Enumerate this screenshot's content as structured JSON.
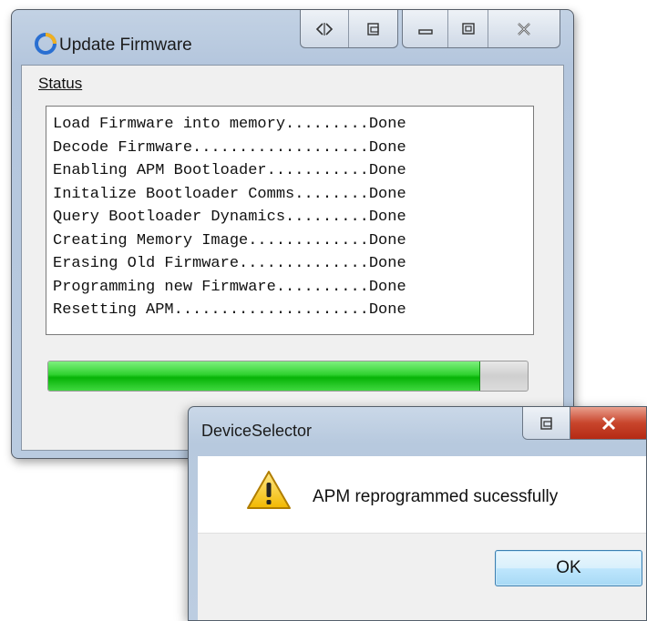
{
  "main_window": {
    "title": "Update Firmware",
    "status_label": "Status",
    "status_lines": [
      "Load Firmware into memory.........Done",
      "Decode Firmware...................Done",
      "Enabling APM Bootloader...........Done",
      "Initalize Bootloader Comms........Done",
      "Query Bootloader Dynamics.........Done",
      "Creating Memory Image.............Done",
      "Erasing Old Firmware..............Done",
      "Programming new Firmware..........Done",
      "Resetting APM.....................Done"
    ],
    "progress_fraction": 0.9,
    "titlebar_icons": [
      "split-icon",
      "restore-icon",
      "minimize-icon",
      "maximize-icon",
      "close-icon"
    ]
  },
  "dialog": {
    "title": "DeviceSelector",
    "message": "APM reprogrammed sucessfully",
    "ok_label": "OK",
    "icon": "warning-icon"
  },
  "colors": {
    "progress_green": "#07b307",
    "close_red": "#c8452c",
    "ok_border": "#3c7fb1"
  }
}
